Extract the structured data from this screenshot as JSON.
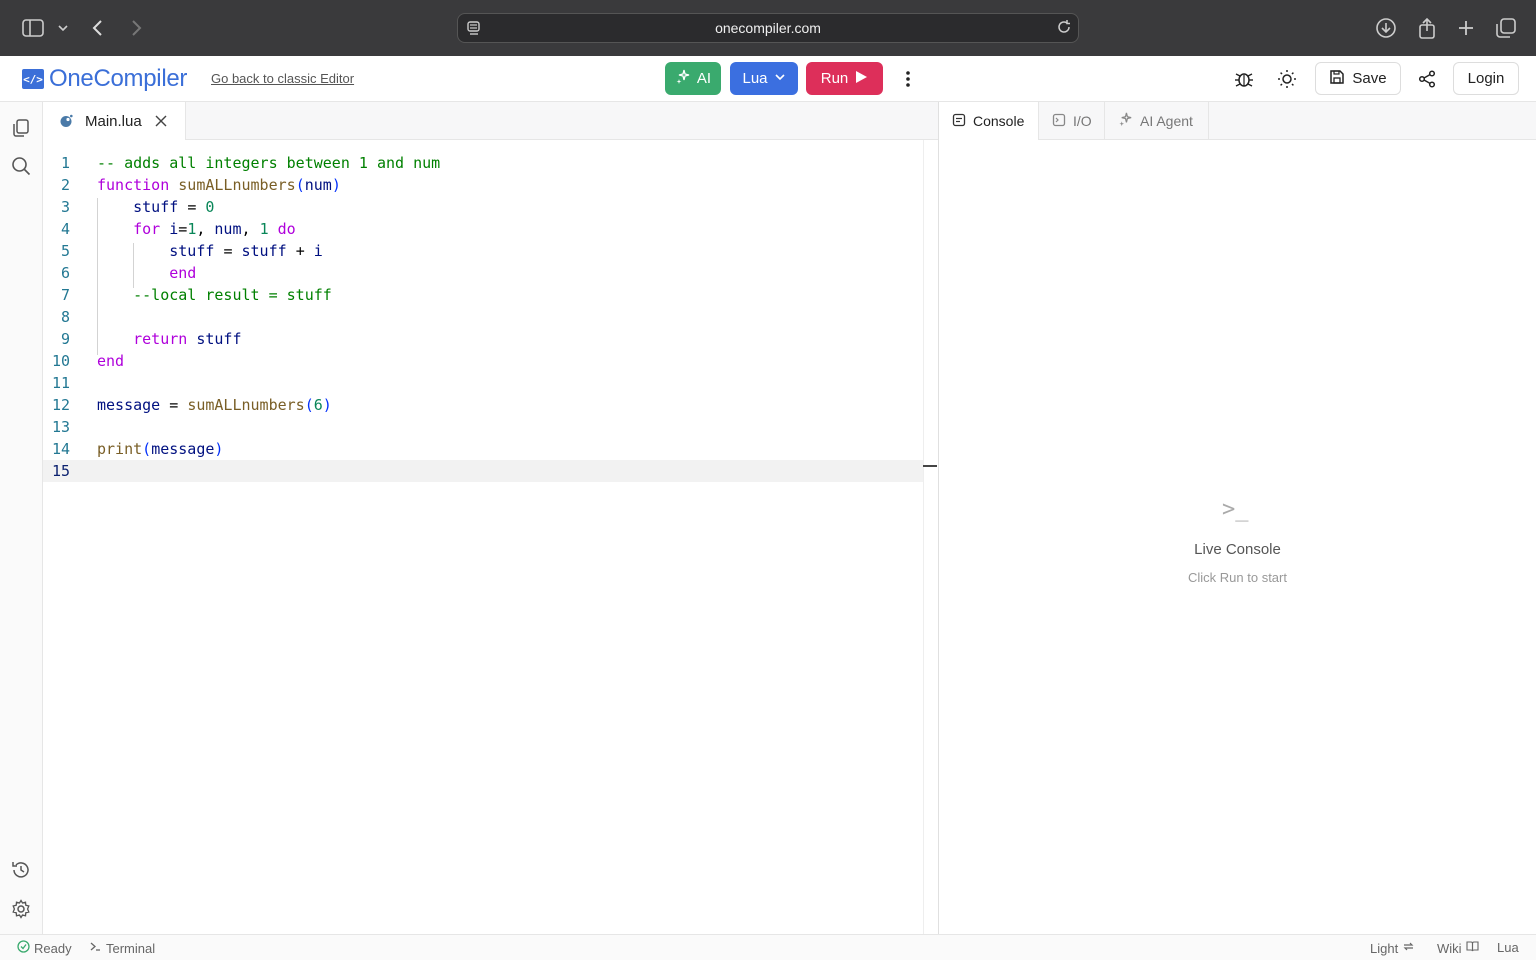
{
  "browser": {
    "url": "onecompiler.com"
  },
  "header": {
    "logo_text": "OneCompiler",
    "logo_badge": "</>",
    "classic_link": "Go back to classic Editor",
    "ai_label": "AI",
    "language_label": "Lua",
    "run_label": "Run",
    "save_label": "Save",
    "login_label": "Login"
  },
  "editor": {
    "tab_filename": "Main.lua",
    "active_line": 15,
    "line_numbers": [
      "1",
      "2",
      "3",
      "4",
      "5",
      "6",
      "7",
      "8",
      "9",
      "10",
      "11",
      "12",
      "13",
      "14",
      "15"
    ],
    "code_lines": [
      "-- adds all integers between 1 and num",
      "function sumALLnumbers(num)",
      "    stuff = 0",
      "    for i=1, num, 1 do",
      "        stuff = stuff + i",
      "        end",
      "    --local result = stuff",
      "",
      "    return stuff",
      "end",
      "",
      "message = sumALLnumbers(6)",
      "",
      "print(message)",
      ""
    ]
  },
  "panel": {
    "tabs": [
      "Console",
      "I/O",
      "AI Agent"
    ],
    "active_tab": "Console",
    "empty_icon": ">_",
    "empty_title": "Live Console",
    "empty_subtitle": "Click Run to start"
  },
  "status_bar": {
    "ready": "Ready",
    "terminal": "Terminal",
    "theme": "Light",
    "wiki": "Wiki",
    "language": "Lua"
  },
  "colors": {
    "ai_green": "#3aaa6e",
    "lang_blue": "#3b6fe0",
    "run_red": "#dd2f5a",
    "brand_blue": "#3b6fd8"
  },
  "icons": [
    "sidebar-icon",
    "chevron-down-icon",
    "back-icon",
    "forward-icon",
    "download-icon",
    "share-icon",
    "new-tab-icon",
    "tabs-icon",
    "reader-icon",
    "reload-icon",
    "sparkle-icon",
    "play-icon",
    "more-vertical-icon",
    "bug-icon",
    "sun-icon",
    "save-icon",
    "share-nodes-icon",
    "files-icon",
    "search-icon",
    "history-icon",
    "settings-icon",
    "lua-icon",
    "close-icon",
    "console-icon",
    "io-icon",
    "check-circle-icon",
    "terminal-icon",
    "refresh-icon",
    "book-icon"
  ]
}
